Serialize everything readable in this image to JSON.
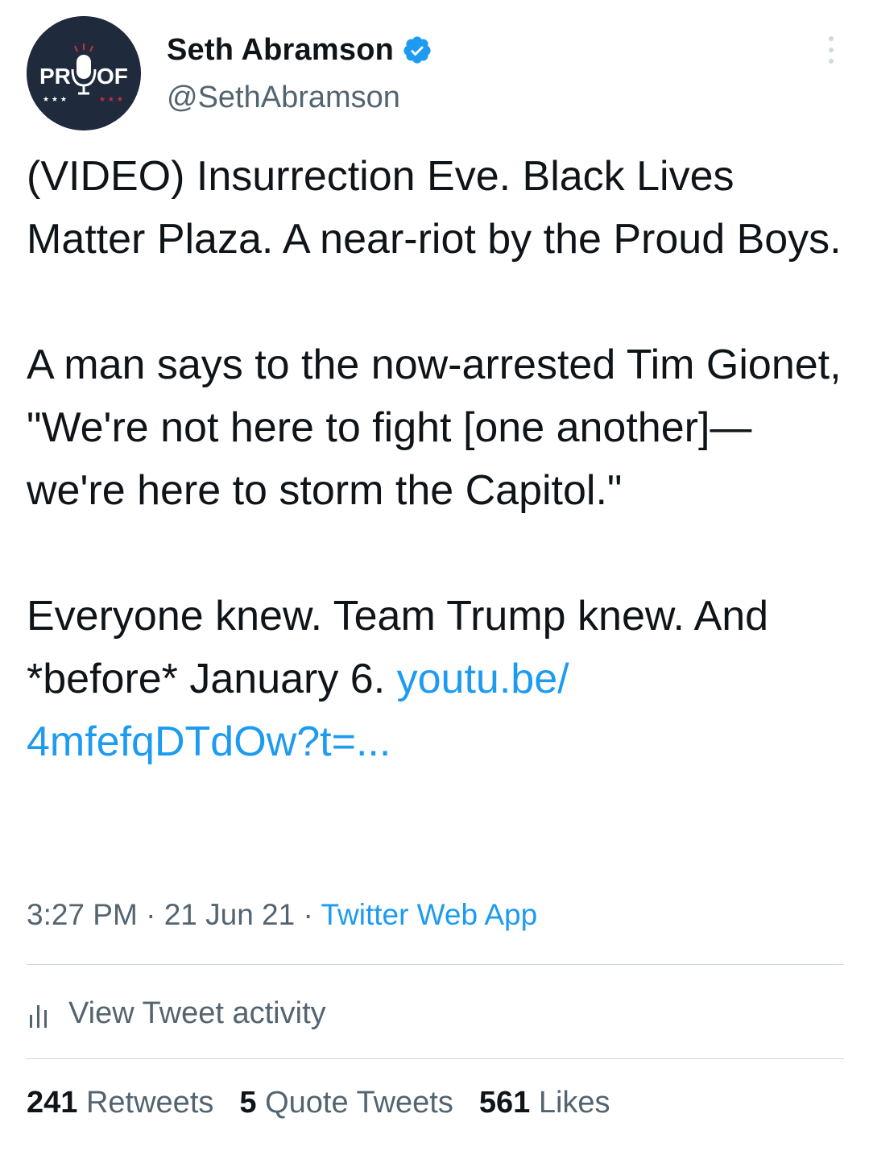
{
  "author": {
    "display_name": "Seth Abramson",
    "handle": "@SethAbramson",
    "avatar_logo_text": "PROOF",
    "verified": true,
    "verified_color": "#1d9bf0"
  },
  "tweet": {
    "paragraph_1": "(VIDEO) Insurrection Eve. Black Lives Matter Plaza. A near-riot by the Proud Boys.",
    "paragraph_2": "A man says to the now-arrested Tim Gionet, \"We're not here to fight [one another]—we're here to storm the Capitol.\"",
    "paragraph_3_text": "Everyone knew. Team Trump knew. And *before* January 6. ",
    "link_text": "youtu.be/ 4mfefqDTdOw?t=..."
  },
  "meta": {
    "time": "3:27 PM",
    "separator_1": " · ",
    "date": "21 Jun 21",
    "separator_2": " · ",
    "source": "Twitter Web App"
  },
  "activity": {
    "label": "View Tweet activity",
    "icon": "bar-chart-icon"
  },
  "stats": {
    "retweets_count": "241",
    "retweets_label": "Retweets",
    "quotes_count": "5",
    "quotes_label": "Quote Tweets",
    "likes_count": "561",
    "likes_label": "Likes"
  },
  "colors": {
    "link": "#1d9bf0",
    "secondary_text": "#536471",
    "primary_text": "#0f1419",
    "divider": "#cfd9de",
    "avatar_bg": "#1f2a3d"
  }
}
